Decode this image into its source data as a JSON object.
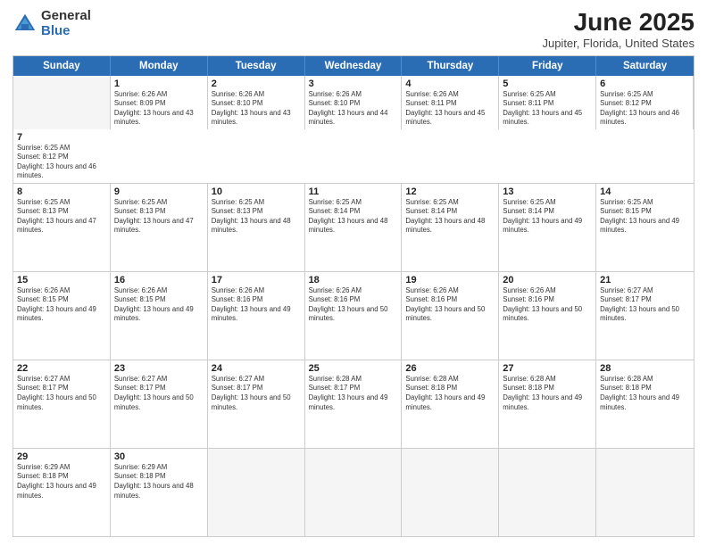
{
  "logo": {
    "general": "General",
    "blue": "Blue"
  },
  "title": "June 2025",
  "subtitle": "Jupiter, Florida, United States",
  "days": [
    "Sunday",
    "Monday",
    "Tuesday",
    "Wednesday",
    "Thursday",
    "Friday",
    "Saturday"
  ],
  "rows": [
    [
      {
        "day": "",
        "empty": true
      },
      {
        "day": "1",
        "rise": "6:26 AM",
        "set": "8:09 PM",
        "daylight": "13 hours and 43 minutes."
      },
      {
        "day": "2",
        "rise": "6:26 AM",
        "set": "8:10 PM",
        "daylight": "13 hours and 43 minutes."
      },
      {
        "day": "3",
        "rise": "6:26 AM",
        "set": "8:10 PM",
        "daylight": "13 hours and 44 minutes."
      },
      {
        "day": "4",
        "rise": "6:26 AM",
        "set": "8:11 PM",
        "daylight": "13 hours and 45 minutes."
      },
      {
        "day": "5",
        "rise": "6:25 AM",
        "set": "8:11 PM",
        "daylight": "13 hours and 45 minutes."
      },
      {
        "day": "6",
        "rise": "6:25 AM",
        "set": "8:12 PM",
        "daylight": "13 hours and 46 minutes."
      },
      {
        "day": "7",
        "rise": "6:25 AM",
        "set": "8:12 PM",
        "daylight": "13 hours and 46 minutes."
      }
    ],
    [
      {
        "day": "8",
        "rise": "6:25 AM",
        "set": "8:13 PM",
        "daylight": "13 hours and 47 minutes."
      },
      {
        "day": "9",
        "rise": "6:25 AM",
        "set": "8:13 PM",
        "daylight": "13 hours and 47 minutes."
      },
      {
        "day": "10",
        "rise": "6:25 AM",
        "set": "8:13 PM",
        "daylight": "13 hours and 48 minutes."
      },
      {
        "day": "11",
        "rise": "6:25 AM",
        "set": "8:14 PM",
        "daylight": "13 hours and 48 minutes."
      },
      {
        "day": "12",
        "rise": "6:25 AM",
        "set": "8:14 PM",
        "daylight": "13 hours and 48 minutes."
      },
      {
        "day": "13",
        "rise": "6:25 AM",
        "set": "8:14 PM",
        "daylight": "13 hours and 49 minutes."
      },
      {
        "day": "14",
        "rise": "6:25 AM",
        "set": "8:15 PM",
        "daylight": "13 hours and 49 minutes."
      }
    ],
    [
      {
        "day": "15",
        "rise": "6:26 AM",
        "set": "8:15 PM",
        "daylight": "13 hours and 49 minutes."
      },
      {
        "day": "16",
        "rise": "6:26 AM",
        "set": "8:15 PM",
        "daylight": "13 hours and 49 minutes."
      },
      {
        "day": "17",
        "rise": "6:26 AM",
        "set": "8:16 PM",
        "daylight": "13 hours and 49 minutes."
      },
      {
        "day": "18",
        "rise": "6:26 AM",
        "set": "8:16 PM",
        "daylight": "13 hours and 50 minutes."
      },
      {
        "day": "19",
        "rise": "6:26 AM",
        "set": "8:16 PM",
        "daylight": "13 hours and 50 minutes."
      },
      {
        "day": "20",
        "rise": "6:26 AM",
        "set": "8:16 PM",
        "daylight": "13 hours and 50 minutes."
      },
      {
        "day": "21",
        "rise": "6:27 AM",
        "set": "8:17 PM",
        "daylight": "13 hours and 50 minutes."
      }
    ],
    [
      {
        "day": "22",
        "rise": "6:27 AM",
        "set": "8:17 PM",
        "daylight": "13 hours and 50 minutes."
      },
      {
        "day": "23",
        "rise": "6:27 AM",
        "set": "8:17 PM",
        "daylight": "13 hours and 50 minutes."
      },
      {
        "day": "24",
        "rise": "6:27 AM",
        "set": "8:17 PM",
        "daylight": "13 hours and 50 minutes."
      },
      {
        "day": "25",
        "rise": "6:28 AM",
        "set": "8:17 PM",
        "daylight": "13 hours and 49 minutes."
      },
      {
        "day": "26",
        "rise": "6:28 AM",
        "set": "8:18 PM",
        "daylight": "13 hours and 49 minutes."
      },
      {
        "day": "27",
        "rise": "6:28 AM",
        "set": "8:18 PM",
        "daylight": "13 hours and 49 minutes."
      },
      {
        "day": "28",
        "rise": "6:28 AM",
        "set": "8:18 PM",
        "daylight": "13 hours and 49 minutes."
      }
    ],
    [
      {
        "day": "29",
        "rise": "6:29 AM",
        "set": "8:18 PM",
        "daylight": "13 hours and 49 minutes."
      },
      {
        "day": "30",
        "rise": "6:29 AM",
        "set": "8:18 PM",
        "daylight": "13 hours and 48 minutes."
      },
      {
        "day": "",
        "empty": true
      },
      {
        "day": "",
        "empty": true
      },
      {
        "day": "",
        "empty": true
      },
      {
        "day": "",
        "empty": true
      },
      {
        "day": "",
        "empty": true
      }
    ]
  ]
}
